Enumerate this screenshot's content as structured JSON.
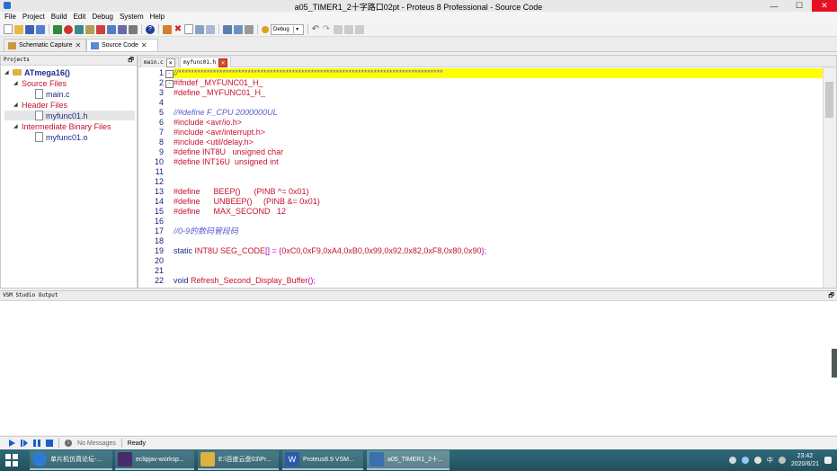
{
  "window": {
    "title": "a05_TIMER1_2十字路口02pt - Proteus 8 Professional - Source Code",
    "controls": [
      "—",
      "☐",
      "✕"
    ]
  },
  "menu": [
    "File",
    "Project",
    "Build",
    "Edit",
    "Debug",
    "System",
    "Help"
  ],
  "toolbar": {
    "debug_label": "Debug",
    "icons": [
      "new-file-icon",
      "open-folder-icon",
      "save-icon",
      "save-all-icon",
      "build-icon",
      "stop-build-icon",
      "rebuild-icon",
      "component-icon",
      "schematic-icon",
      "pcb-icon",
      "help-icon",
      "refresh-icon",
      "delete-icon",
      "new-doc-icon",
      "copy-icon",
      "paste-icon",
      "print-icon",
      "find-icon",
      "replace-icon",
      "compile-icon",
      "debug-icon",
      "undo-icon",
      "redo-icon",
      "cut-icon",
      "copy2-icon",
      "paste2-icon"
    ]
  },
  "tabs": [
    {
      "label": "Schematic Capture",
      "active": false
    },
    {
      "label": "Source Code",
      "active": true
    }
  ],
  "projects": {
    "header": "Projects",
    "tree": [
      {
        "label": "ATmega16()",
        "type": "root",
        "level": 0
      },
      {
        "label": "Source Files",
        "type": "folder",
        "level": 1
      },
      {
        "label": "main.c",
        "type": "file",
        "level": 2
      },
      {
        "label": "Header Files",
        "type": "folder",
        "level": 1
      },
      {
        "label": "myfunc01.h",
        "type": "file",
        "level": 2,
        "selected": true
      },
      {
        "label": "Intermediate Binary Files",
        "type": "folder",
        "level": 1
      },
      {
        "label": "myfunc01.o",
        "type": "file",
        "level": 2
      }
    ]
  },
  "editor": {
    "tabs": [
      {
        "label": "main.c",
        "active": false
      },
      {
        "label": "myfunc01.h",
        "active": true
      }
    ],
    "lines": [
      {
        "n": "1",
        "text": "//************************************************************************************",
        "kind": "cm",
        "hl": true,
        "fold": "-"
      },
      {
        "n": "2",
        "text": "#ifndef _MYFUNC01_H_",
        "kind": "pp",
        "fold": "-"
      },
      {
        "n": "3",
        "text": "#define _MYFUNC01_H_",
        "kind": "pp"
      },
      {
        "n": "4",
        "text": "",
        "kind": "pp"
      },
      {
        "n": "5",
        "text": "//#define F_CPU 2000000UL",
        "kind": "cm"
      },
      {
        "n": "6",
        "text": "#include <avr/io.h>",
        "kind": "pp"
      },
      {
        "n": "7",
        "text": "#include <avr/interrupt.h>",
        "kind": "pp"
      },
      {
        "n": "8",
        "text": "#include <util/delay.h>",
        "kind": "pp"
      },
      {
        "n": "9",
        "text": "#define INT8U   unsigned char",
        "kind": "pp"
      },
      {
        "n": "10",
        "text": "#define INT16U  unsigned int",
        "kind": "pp"
      },
      {
        "n": "11",
        "text": "",
        "kind": "pp"
      },
      {
        "n": "12",
        "text": "",
        "kind": "pp"
      },
      {
        "n": "13",
        "text": "#define      BEEP()      (PINB ^= 0x01)",
        "kind": "pp"
      },
      {
        "n": "14",
        "text": "#define      UNBEEP()     (PINB &= 0x01)",
        "kind": "pp"
      },
      {
        "n": "15",
        "text": "#define      MAX_SECOND   12",
        "kind": "pp"
      },
      {
        "n": "16",
        "text": "",
        "kind": "pp"
      },
      {
        "n": "17",
        "text": "//0-9的数码管段码",
        "kind": "cm"
      },
      {
        "n": "18",
        "text": "",
        "kind": "pp"
      },
      {
        "n": "19",
        "kind": "seg",
        "parts": [
          {
            "t": "static ",
            "c": "kw"
          },
          {
            "t": "INT8U SEG_CODE",
            "c": "txt"
          },
          {
            "t": "[] = {",
            "c": "pn"
          },
          {
            "t": "0xC0,0xF9,0xA4,0xB0,0x99,0x92,0x82,0xF8,0x80,0x90",
            "c": "txt"
          },
          {
            "t": "};",
            "c": "pn"
          }
        ]
      },
      {
        "n": "20",
        "text": "",
        "kind": "pp"
      },
      {
        "n": "21",
        "text": "",
        "kind": "pp"
      },
      {
        "n": "22",
        "kind": "seg",
        "parts": [
          {
            "t": "void ",
            "c": "kw"
          },
          {
            "t": "Refresh_Second_Display_Buffer",
            "c": "txt"
          },
          {
            "t": "();",
            "c": "pn"
          }
        ]
      }
    ]
  },
  "output": {
    "header": "VSM Studio Output"
  },
  "statusbar": {
    "messages": "No Messages",
    "state": "Ready"
  },
  "taskbar": {
    "items": [
      {
        "label": "单片机仿真论坛-...",
        "color": "#2b7bd6",
        "active": false
      },
      {
        "label": "eclipjav-worksp...",
        "color": "#4a2b6a",
        "active": false
      },
      {
        "label": "E:\\百度云盘03\\Pr...",
        "color": "#e0b040",
        "active": false
      },
      {
        "label": "Proteus8.9 VSM...",
        "color": "#2b5aa6",
        "active": false
      },
      {
        "label": "a05_TIMER1_2十...",
        "color": "#3a6fb0",
        "active": true
      }
    ],
    "tray_lang": "中",
    "time": "23:42",
    "date": "2020/6/21"
  },
  "colors": {
    "highlight": "#ffff00",
    "preproc": "#c8102e",
    "comment": "#5a5acf",
    "keyword": "#1a2c8c",
    "punct": "#c000c0"
  }
}
